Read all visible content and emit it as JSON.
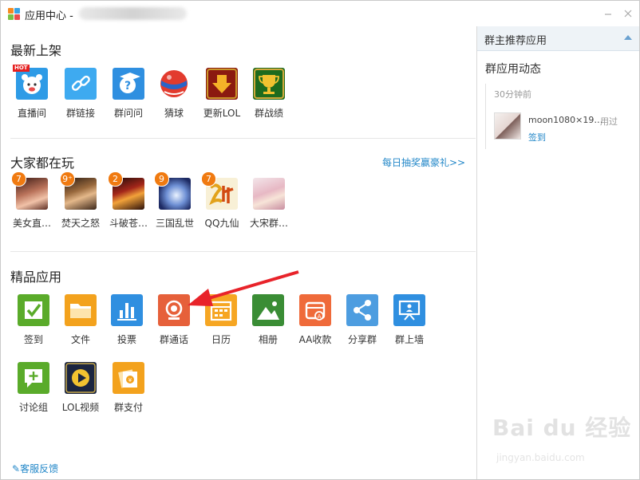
{
  "window": {
    "title": "应用中心 -"
  },
  "sections": {
    "new": {
      "title": "最新上架"
    },
    "popular": {
      "title": "大家都在玩",
      "promo": "每日抽奖赢豪礼>>"
    },
    "featured": {
      "title": "精品应用"
    }
  },
  "new_apps": [
    {
      "label": "直播间",
      "icon": "live-bear-icon",
      "tag": "HOT"
    },
    {
      "label": "群链接",
      "icon": "link-icon"
    },
    {
      "label": "群问问",
      "icon": "question-cap-icon"
    },
    {
      "label": "猜球",
      "icon": "ball-icon"
    },
    {
      "label": "更新LOL",
      "icon": "download-arrow-icon"
    },
    {
      "label": "群战绩",
      "icon": "trophy-icon"
    }
  ],
  "games": [
    {
      "label": "美女直…",
      "badge": "7",
      "icon": "game-beauty-icon"
    },
    {
      "label": "焚天之怒",
      "badge": "9⁺",
      "icon": "game-fentian-icon"
    },
    {
      "label": "斗破苍…",
      "badge": "2",
      "icon": "game-doupo-icon"
    },
    {
      "label": "三国乱世",
      "badge": "9",
      "icon": "game-sanguo-icon"
    },
    {
      "label": "QQ九仙",
      "badge": "7",
      "icon": "game-jiuxian-icon"
    },
    {
      "label": "大宋群…",
      "icon": "game-dasong-icon"
    }
  ],
  "featured_apps": [
    {
      "label": "签到",
      "icon": "checkin-icon"
    },
    {
      "label": "文件",
      "icon": "folder-icon"
    },
    {
      "label": "投票",
      "icon": "vote-chart-icon"
    },
    {
      "label": "群通话",
      "icon": "group-call-icon"
    },
    {
      "label": "日历",
      "icon": "calendar-icon"
    },
    {
      "label": "相册",
      "icon": "album-icon"
    },
    {
      "label": "AA收款",
      "icon": "aa-payment-icon"
    },
    {
      "label": "分享群",
      "icon": "share-icon"
    },
    {
      "label": "群上墙",
      "icon": "wall-screen-icon"
    },
    {
      "label": "讨论组",
      "icon": "discussion-icon"
    },
    {
      "label": "LOL视频",
      "icon": "video-play-icon"
    },
    {
      "label": "群支付",
      "icon": "group-pay-icon"
    }
  ],
  "feedback": "客服反馈",
  "sidebar": {
    "header": "群主推荐应用",
    "title": "群应用动态",
    "activity": {
      "time": "30分钟前",
      "file": "moon1080×19…",
      "used": "用过",
      "action": "签到"
    }
  },
  "colors": {
    "link": "#2287c8",
    "badge": "#f07a10",
    "arrow": "#e8232a"
  },
  "watermark": {
    "logo": "Bai du 经验",
    "url": "jingyan.baidu.com"
  }
}
